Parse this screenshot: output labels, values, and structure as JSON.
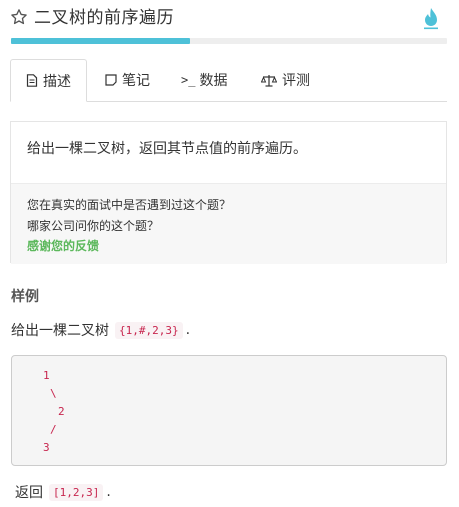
{
  "header": {
    "title": "二叉树的前序遍历"
  },
  "progress": {
    "fraction": 0.41,
    "color": "#4ec1d8"
  },
  "tabs": [
    {
      "label": "描述",
      "icon": "document-icon",
      "active": true
    },
    {
      "label": "笔记",
      "icon": "note-icon",
      "active": false
    },
    {
      "label": "数据",
      "icon": "terminal-icon",
      "icon_text": ">_",
      "active": false
    },
    {
      "label": "评测",
      "icon": "scale-icon",
      "active": false
    }
  ],
  "description": {
    "text": "给出一棵二叉树，返回其节点值的前序遍历。",
    "question1": "您在真实的面试中是否遇到过这个题？",
    "question2": "哪家公司问你的这个题？",
    "feedback": "感谢您的反馈"
  },
  "example": {
    "section_title": "样例",
    "intro": "给出一棵二叉树",
    "tree_inline": "{1,#,2,3}",
    "period": ".",
    "tree_lines": [
      "1",
      "\\",
      "2",
      "/",
      "3"
    ],
    "return_label": "返回",
    "result": "[1,2,3]",
    "return_period": "."
  },
  "colors": {
    "accent": "#4ec1d8",
    "code": "#c7254e",
    "feedback": "#5cb85c"
  }
}
